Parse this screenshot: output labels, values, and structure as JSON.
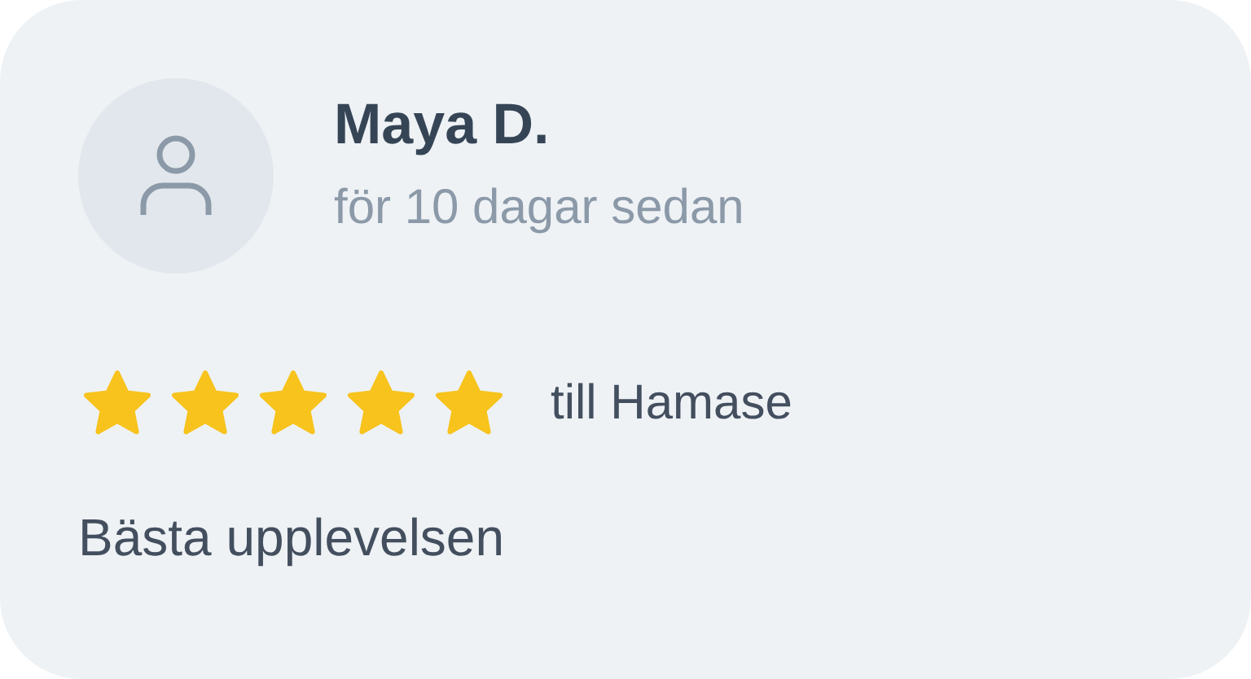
{
  "review": {
    "author": "Maya D.",
    "time": "för 10 dagar sedan",
    "stars": 5,
    "target": "till Hamase",
    "text": "Bästa upplevelsen"
  }
}
